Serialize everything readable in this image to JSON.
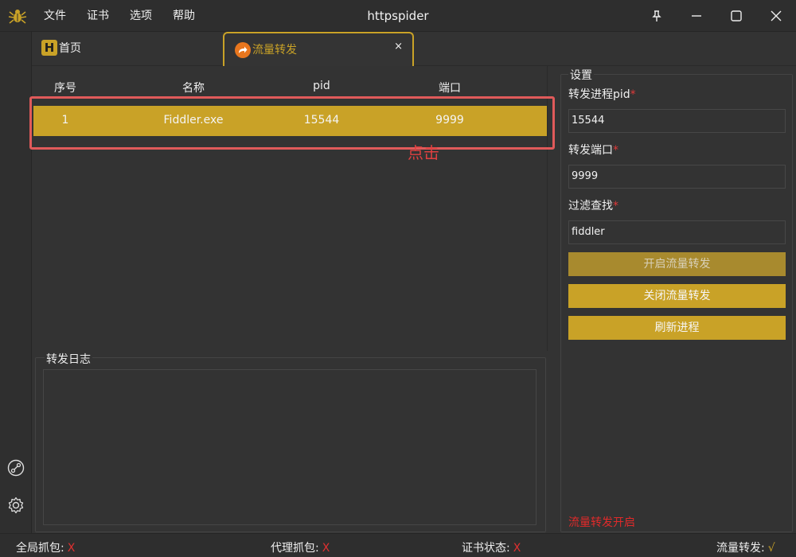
{
  "titlebar": {
    "app_name": "httpspider",
    "menu": [
      "文件",
      "证书",
      "选项",
      "帮助"
    ]
  },
  "tabs": {
    "home_label": "首页",
    "home_badge": "H",
    "active_label": "流量转发",
    "close_glyph": "×"
  },
  "table": {
    "columns": [
      "序号",
      "名称",
      "pid",
      "端口"
    ],
    "rows": [
      {
        "index": "1",
        "name": "Fiddler.exe",
        "pid": "15544",
        "port": "9999"
      }
    ]
  },
  "annotation": {
    "text": "点击"
  },
  "log": {
    "title": "转发日志"
  },
  "settings": {
    "title": "设置",
    "pid_label": "转发进程pid",
    "pid_value": "15544",
    "port_label": "转发端口",
    "port_value": "9999",
    "filter_label": "过滤查找",
    "filter_value": "fiddler",
    "required_mark": "*",
    "btn_start": "开启流量转发",
    "btn_stop": "关闭流量转发",
    "btn_refresh": "刷新进程",
    "status_message": "流量转发开启"
  },
  "statusbar": {
    "global_capture_label": "全局抓包:",
    "global_capture_value": "X",
    "proxy_capture_label": "代理抓包:",
    "proxy_capture_value": "X",
    "cert_status_label": "证书状态:",
    "cert_status_value": "X",
    "forward_label": "流量转发:",
    "forward_value": "√"
  },
  "colors": {
    "accent": "#c9a227",
    "background": "#333333",
    "error": "#e03030",
    "annotation": "#e05a5a"
  },
  "icons": [
    "spider-icon",
    "pin-icon",
    "minimize-icon",
    "maximize-icon",
    "close-icon",
    "link-icon",
    "gear-icon",
    "forward-arrow-icon"
  ]
}
